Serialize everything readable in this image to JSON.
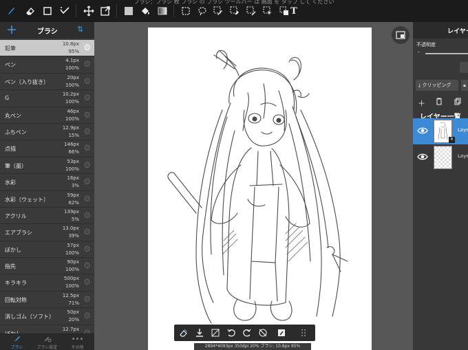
{
  "top_hint": "ブラシ：ブラシ 枚 ブラシ の ブラシ ツールバー は 画面 を タップ して ください",
  "toolbar": {
    "icons": [
      "brush-icon",
      "eraser-icon",
      "rect-select-icon",
      "magic-wand-icon",
      "move-icon",
      "transform-icon",
      "color-swatch-icon",
      "fill-bucket-icon",
      "gradient-icon",
      "select-rect-icon",
      "select-lasso-icon",
      "select-pen-icon",
      "select-eraser-icon",
      "select-wand-icon",
      "select-move-icon",
      "text-tool-icon"
    ],
    "text_tool": "T"
  },
  "brush_panel": {
    "add": "+",
    "title": "ブラシ",
    "sort": "⇅",
    "brushes": [
      {
        "name": "鉛筆",
        "size": "10.8px",
        "opacity": "95%",
        "selected": true
      },
      {
        "name": "ペン",
        "size": "4.1px",
        "opacity": "100%"
      },
      {
        "name": "ペン（入り抜き）",
        "size": "20px",
        "opacity": "100%"
      },
      {
        "name": "G",
        "size": "10.2px",
        "opacity": "100%"
      },
      {
        "name": "丸ペン",
        "size": "46px",
        "opacity": "100%"
      },
      {
        "name": "ふちペン",
        "size": "12.9px",
        "opacity": "15%"
      },
      {
        "name": "点描",
        "size": "146px",
        "opacity": "66%"
      },
      {
        "name": "筆（墨）",
        "size": "53px",
        "opacity": "100%"
      },
      {
        "name": "水彩",
        "size": "16px",
        "opacity": "3%"
      },
      {
        "name": "水彩（ウェット）",
        "size": "59px",
        "opacity": "62%"
      },
      {
        "name": "アクリル",
        "size": "139px",
        "opacity": "5%"
      },
      {
        "name": "エアブラシ",
        "size": "13.0px",
        "opacity": "39%"
      },
      {
        "name": "ぼかし",
        "size": "57px",
        "opacity": "100%"
      },
      {
        "name": "指先",
        "size": "90px",
        "opacity": "100%"
      },
      {
        "name": "キラキラ",
        "size": "500px",
        "opacity": "100%"
      },
      {
        "name": "回転対称",
        "size": "12.5px",
        "opacity": "71%"
      },
      {
        "name": "消しゴム（ソフト）",
        "size": "50px",
        "opacity": "20%"
      },
      {
        "name": "ぼかし",
        "size": "12.7px",
        "opacity": ""
      }
    ],
    "tabs": [
      {
        "label": "ブラシ",
        "active": true
      },
      {
        "label": "ブラシ設定",
        "active": false
      },
      {
        "label": "その他",
        "active": false
      }
    ]
  },
  "canvas": {
    "status": "2894*4093px 350dpi 20% ブラシ: 10.8px 95%"
  },
  "layer_panel": {
    "title": "レイヤー",
    "opacity_label": "不透明度",
    "opacity_minus": "-",
    "clipping_label": "クリッピング",
    "lock_label": "",
    "list_title": "レイヤー一覧",
    "layers": [
      {
        "name": "Layer",
        "active": true,
        "badge": "8"
      },
      {
        "name": "Layer",
        "active": false
      }
    ]
  }
}
